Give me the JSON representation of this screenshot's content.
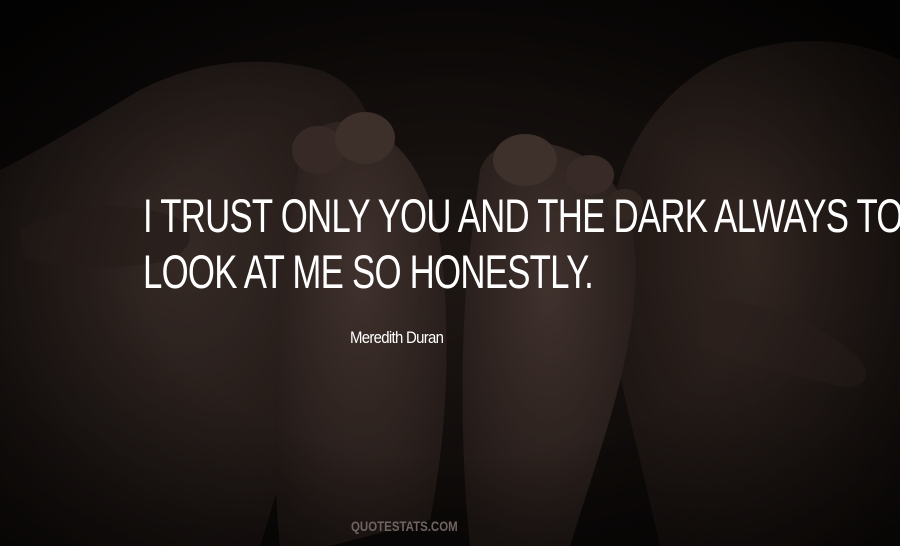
{
  "quote": {
    "lines": [
      "I TRUST ONLY YOU AND THE DARK ALWAYS TO",
      "LOOK AT ME SO HONESTLY."
    ]
  },
  "author": "Meredith Duran",
  "watermark": "QUOTESTATS.COM",
  "colors": {
    "text": "#ffffff",
    "watermark": "#6f6462",
    "background": "#15100e"
  }
}
